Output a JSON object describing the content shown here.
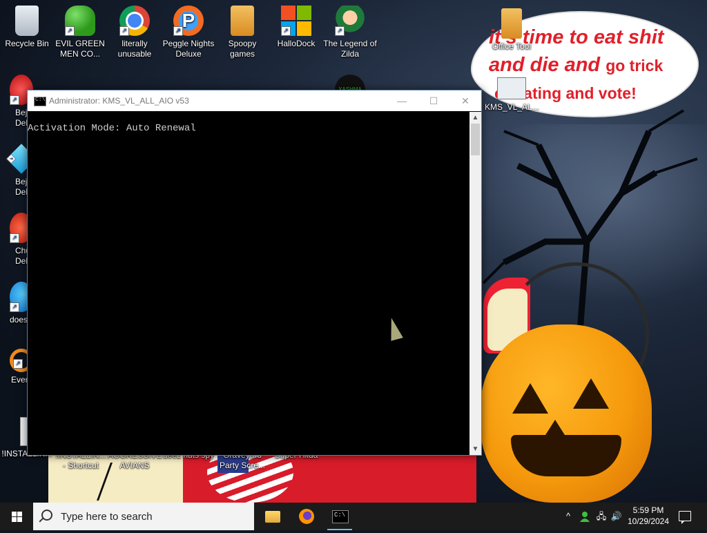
{
  "desktop": {
    "speech_bubble": {
      "line1": "it's time to eat shit",
      "line2_bold": "and die and ",
      "line2_small": "go trick",
      "line3": "or eating and vote!"
    },
    "icons": [
      {
        "label": "Recycle Bin"
      },
      {
        "label": "EVIL GREEN MEN CO..."
      },
      {
        "label": "literally unusable"
      },
      {
        "label": "Peggle Nights Deluxe"
      },
      {
        "label": "Spoopy games"
      },
      {
        "label": "HalloDock"
      },
      {
        "label": "The Legend of Zilda"
      },
      {
        "label": "Office Tool"
      },
      {
        "label": "KMS_VL_AL..."
      },
      {
        "label": "Bejew Delu"
      },
      {
        "label": "Bejew Delu"
      },
      {
        "label": "Chu Delu"
      },
      {
        "label": "doesn"
      },
      {
        "label": "Every"
      },
      {
        "label": "!INSTALLIN..."
      },
      {
        "label": "!INSTALLIN... - Shortcut"
      },
      {
        "label": "AGGRESSIVE AVIANS"
      },
      {
        "label": "deez nuts spy"
      },
      {
        "label": "Graveyard Party Scre..."
      },
      {
        "label": "Super Hilda"
      },
      {
        "label": "XASHMA"
      }
    ]
  },
  "cmd_window": {
    "title": "Administrator:  KMS_VL_ALL_AIO v53",
    "minimize": "—",
    "maximize": "☐",
    "close": "✕",
    "output_line": "Activation Mode: Auto Renewal"
  },
  "taskbar": {
    "search_placeholder": "Type here to search",
    "tray_chevron": "^",
    "network_icon": "🖧",
    "volume_icon": "🔊",
    "time": "5:59 PM",
    "date": "10/29/2024"
  }
}
